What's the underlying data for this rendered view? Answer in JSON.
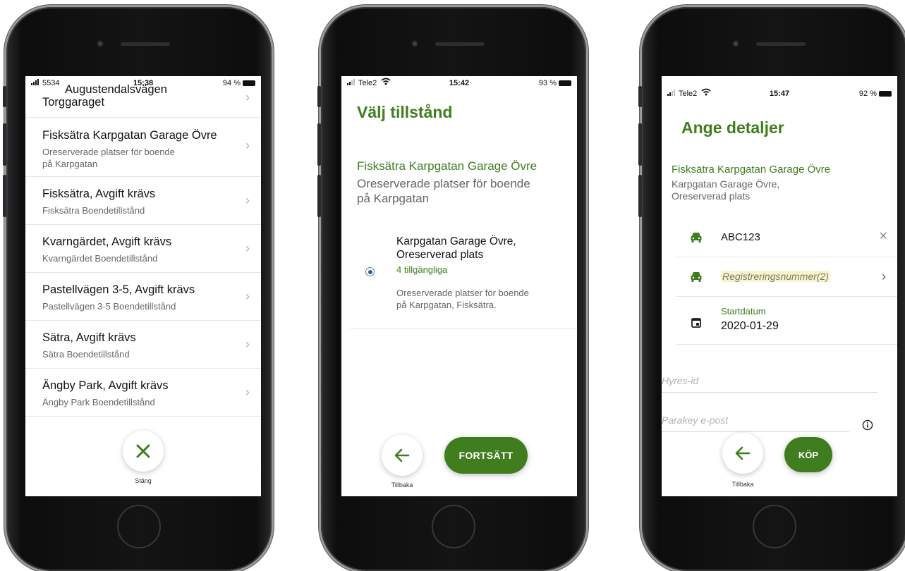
{
  "phone1": {
    "status": {
      "carrier": "5534",
      "time": "15:38",
      "battery": "94 %"
    },
    "rows": [
      {
        "title": "Augustendalsvägen",
        "subtitle": "Torggaraget"
      },
      {
        "title": "Fisksätra Karpgatan Garage Övre",
        "subtitle": "Oreserverade platser för boende",
        "subtitle2": "på Karpgatan"
      },
      {
        "title": "Fisksätra, Avgift krävs",
        "subtitle": "Fisksätra Boendetillstånd"
      },
      {
        "title": "Kvarngärdet, Avgift krävs",
        "subtitle": "Kvarngärdet Boendetillstånd"
      },
      {
        "title": "Pastellvägen 3-5, Avgift krävs",
        "subtitle": "Pastellvägen 3-5 Boendetillstånd"
      },
      {
        "title": "Sätra, Avgift krävs",
        "subtitle": "Sätra Boendetillstånd"
      },
      {
        "title": "Ängby Park, Avgift krävs",
        "subtitle": "Ängby Park Boendetillstånd"
      }
    ],
    "close_label": "Stäng"
  },
  "phone2": {
    "status": {
      "carrier": "Tele2",
      "time": "15:42",
      "battery": "93 %"
    },
    "heading": "Välj tillstånd",
    "location_title": "Fisksätra Karpgatan Garage Övre",
    "location_desc1": "Oreserverade platser för boende",
    "location_desc2": "på Karpgatan",
    "option": {
      "name1": "Karpgatan Garage Övre,",
      "name2": "Oreserverad plats",
      "availability": "4 tillgängliga",
      "desc1": "Oreserverade platser för boende",
      "desc2": "på Karpgatan, Fisksätra."
    },
    "back_label": "Tillbaka",
    "continue_label": "FORTSÄTT"
  },
  "phone3": {
    "status": {
      "carrier": "Tele2",
      "time": "15:47",
      "battery": "92 %"
    },
    "heading": "Ange detaljer",
    "location_title": "Fisksätra Karpgatan Garage Övre",
    "location_desc1": "Karpgatan Garage Övre,",
    "location_desc2": "Oreserverad plats",
    "plate1": "ABC123",
    "plate2_placeholder": "Registreringsnummer(2)",
    "start_label": "Startdatum",
    "start_value": "2020-01-29",
    "rent_id_placeholder": "Hyres-id",
    "email_placeholder": "Parakey e-post",
    "back_label": "Tillbaka",
    "buy_label": "KÖP"
  },
  "colors": {
    "accent": "#3f7d1f",
    "highlight": "#fbf4c8"
  },
  "icons": [
    "signal-icon",
    "wifi-icon",
    "battery-icon",
    "chevron-right-icon",
    "close-icon",
    "arrow-left-icon",
    "radio-selected-icon",
    "car-icon",
    "calendar-icon",
    "clear-icon",
    "info-icon"
  ]
}
